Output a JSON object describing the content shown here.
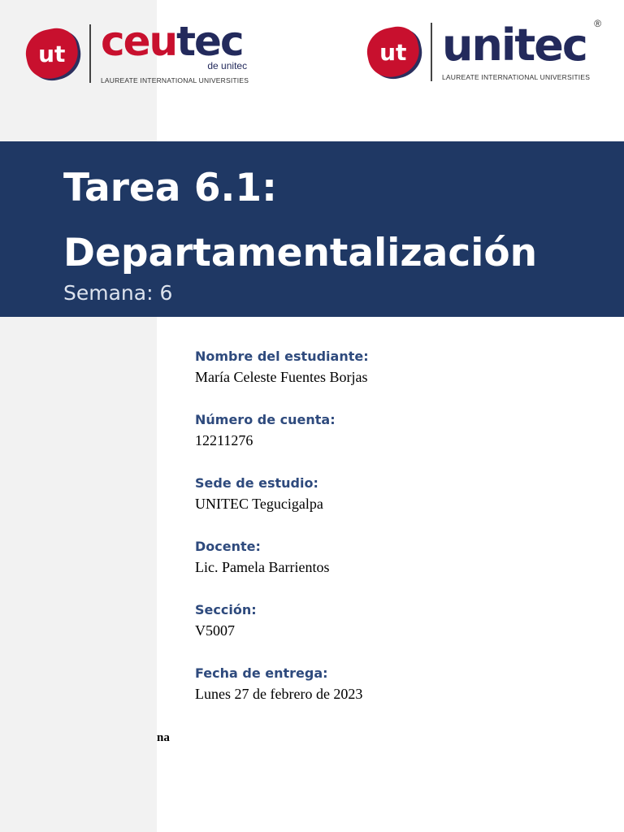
{
  "logos": {
    "left": {
      "mark": "ut",
      "name_part1": "ceu",
      "name_part2": "tec",
      "sub": "de unitec",
      "tagline": "LAUREATE INTERNATIONAL UNIVERSITIES"
    },
    "right": {
      "mark": "ut",
      "name": "unitec",
      "registered": "®",
      "tagline": "LAUREATE INTERNATIONAL UNIVERSITIES"
    }
  },
  "banner": {
    "title_line1": "Tarea 6.1:",
    "title_line2": "Departamentalización",
    "week": "Semana: 6"
  },
  "fields": [
    {
      "label": "Nombre del estudiante:",
      "value": "María Celeste Fuentes Borjas"
    },
    {
      "label": "Número de cuenta:",
      "value": "12211276"
    },
    {
      "label": "Sede de estudio:",
      "value": "UNITEC Tegucigalpa"
    },
    {
      "label": "Docente:",
      "value": "Lic. Pamela Barrientos"
    },
    {
      "label": "Sección:",
      "value": "V5007"
    },
    {
      "label": "Fecha de entrega:",
      "value": "Lunes 27 de febrero de 2023"
    }
  ],
  "fragment": "na",
  "colors": {
    "banner": "#1f3864",
    "label": "#2e4a7d",
    "brand_red": "#c8102e",
    "brand_navy": "#232a5c"
  }
}
